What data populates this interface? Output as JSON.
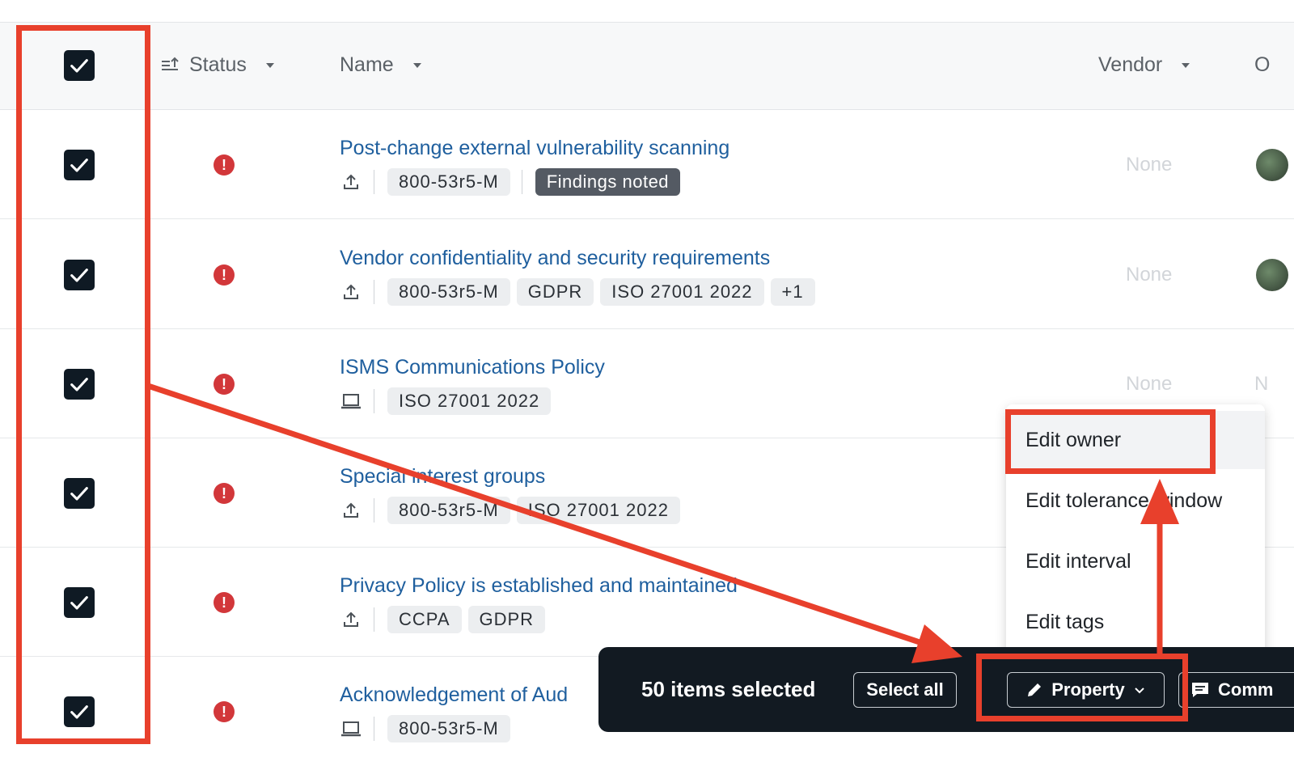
{
  "table": {
    "columns": {
      "status": "Status",
      "name": "Name",
      "vendor": "Vendor",
      "owner_partial": "O"
    },
    "rows": [
      {
        "title": "Post-change external vulnerability scanning",
        "type_icon": "upload-icon",
        "tags": [
          "800-53r5-M"
        ],
        "status_tag": "Findings noted",
        "vendor": "None"
      },
      {
        "title": "Vendor confidentiality and security requirements",
        "type_icon": "upload-icon",
        "tags": [
          "800-53r5-M",
          "GDPR",
          "ISO 27001 2022",
          "+1"
        ],
        "vendor": "None"
      },
      {
        "title": "ISMS Communications Policy",
        "type_icon": "laptop-icon",
        "tags": [
          "ISO 27001 2022"
        ],
        "vendor": "None",
        "owner_partial": "N"
      },
      {
        "title": "Special interest groups",
        "type_icon": "upload-icon",
        "tags": [
          "800-53r5-M",
          "ISO 27001 2022"
        ]
      },
      {
        "title": "Privacy Policy is established and maintained",
        "type_icon": "upload-icon",
        "tags": [
          "CCPA",
          "GDPR"
        ]
      },
      {
        "title": "Acknowledgement of Aud",
        "type_icon": "laptop-icon",
        "tags": [
          "800-53r5-M"
        ]
      }
    ]
  },
  "property_menu": {
    "items": [
      "Edit owner",
      "Edit tolerance window",
      "Edit interval",
      "Edit tags"
    ]
  },
  "bulk_bar": {
    "count_label": "50 items selected",
    "select_all_label": "Select all",
    "property_label": "Property",
    "comment_label": "Comm"
  },
  "colors": {
    "annotation": "#e8402c",
    "link": "#1f5f9e",
    "error": "#d2373a",
    "bar_bg": "#121a22"
  }
}
